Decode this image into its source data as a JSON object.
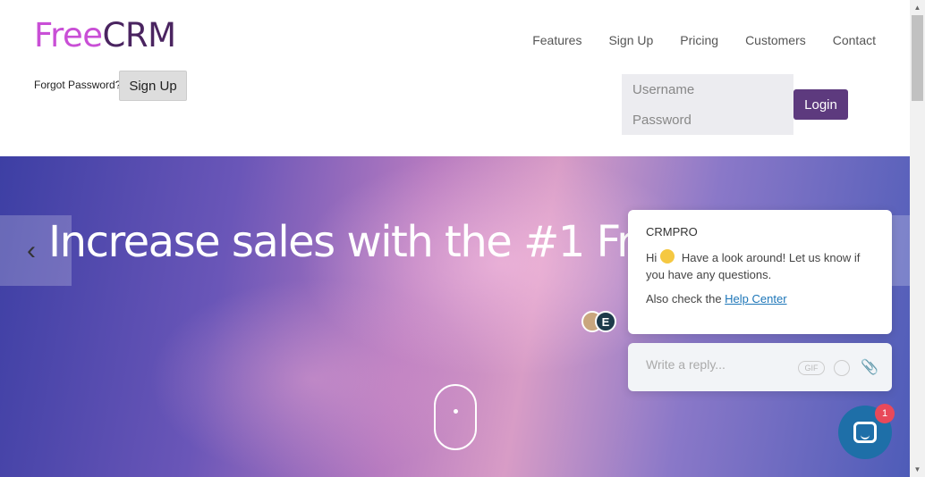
{
  "logo": {
    "part1": "Free",
    "part2": "CRM"
  },
  "nav": [
    "Features",
    "Sign Up",
    "Pricing",
    "Customers",
    "Contact"
  ],
  "forgot_password": "Forgot Password?",
  "signup_button": "Sign Up",
  "login": {
    "username_placeholder": "Username",
    "password_placeholder": "Password",
    "button": "Login"
  },
  "hero": {
    "title": "Increase sales with the #1 Free C"
  },
  "avatars": {
    "second_initial": "E"
  },
  "chat": {
    "sender": "CRMPRO",
    "greeting_before": "Hi",
    "greeting_after": "Have a look around! Let us know if you have any questions.",
    "help_prefix": "Also check the ",
    "help_link": "Help Center",
    "reply_placeholder": "Write a reply...",
    "gif_label": "GIF",
    "unread_count": "1"
  },
  "colors": {
    "logo_free": "#c94fd6",
    "logo_crm": "#4a2460",
    "login_button": "#5d3a7e",
    "chat_launcher": "#1e6fa8",
    "badge": "#e8495a",
    "link": "#1d76b8"
  }
}
